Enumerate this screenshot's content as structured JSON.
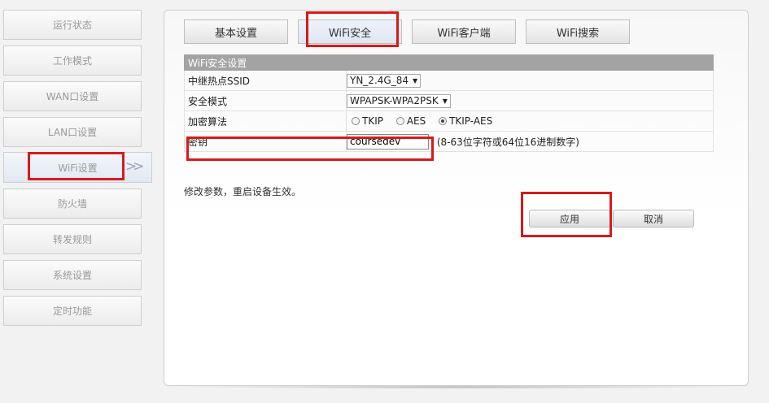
{
  "sidebar": {
    "items": [
      {
        "label": "运行状态"
      },
      {
        "label": "工作模式"
      },
      {
        "label": "WAN口设置"
      },
      {
        "label": "LAN口设置"
      },
      {
        "label": "WiFi设置",
        "active": true
      },
      {
        "label": "防火墙"
      },
      {
        "label": "转发规则"
      },
      {
        "label": "系统设置"
      },
      {
        "label": "定时功能"
      }
    ]
  },
  "tabs": [
    {
      "label": "基本设置"
    },
    {
      "label": "WiFi安全",
      "active": true
    },
    {
      "label": "WiFi客户端"
    },
    {
      "label": "WiFi搜索"
    }
  ],
  "section_title": "WiFi安全设置",
  "form": {
    "ssid": {
      "label": "中继热点SSID",
      "value": "YN_2.4G_84"
    },
    "security_mode": {
      "label": "安全模式",
      "value": "WPAPSK-WPA2PSK"
    },
    "encryption": {
      "label": "加密算法",
      "options": [
        "TKIP",
        "AES",
        "TKIP-AES"
      ],
      "selected": "TKIP-AES"
    },
    "key": {
      "label": "密钥",
      "value": "coursedev",
      "hint": "(8-63位字符或64位16进制数字)"
    }
  },
  "note": "修改参数，重启设备生效。",
  "buttons": {
    "apply": "应用",
    "cancel": "取消"
  },
  "colors": {
    "highlight": "#d71a1a",
    "section_header": "#a3a3a3"
  }
}
